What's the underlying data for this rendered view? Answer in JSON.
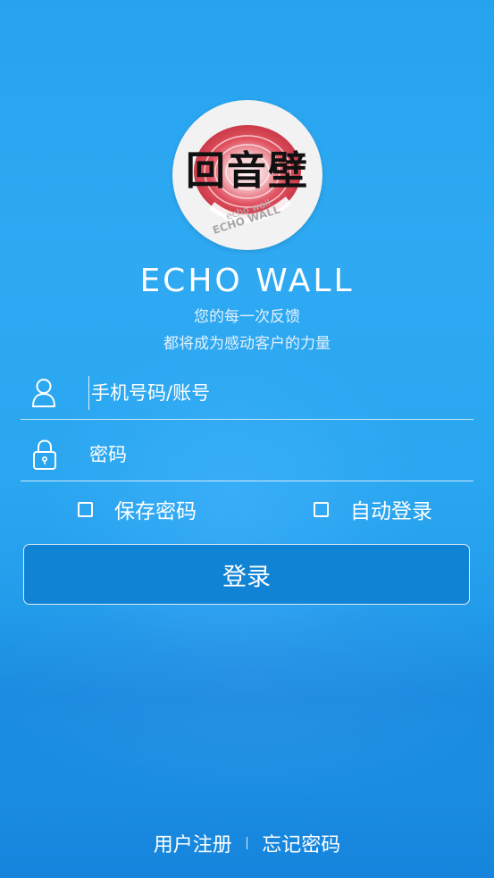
{
  "logo": {
    "chinese": "回音壁",
    "ring_text_1": "echo wall",
    "ring_text_2": "ECHO WALL"
  },
  "brand": {
    "name": "ECHO WALL",
    "tagline_1": "您的每一次反馈",
    "tagline_2": "都将成为感动客户的力量"
  },
  "form": {
    "account_placeholder": "手机号码/账号",
    "password_placeholder": "密码",
    "save_password_label": "保存密码",
    "auto_login_label": "自动登录",
    "save_password_checked": false,
    "auto_login_checked": false,
    "login_button": "登录"
  },
  "footer": {
    "register_link": "用户注册",
    "forgot_link": "忘记密码"
  },
  "icons": {
    "account": "user-icon",
    "password": "lock-icon"
  },
  "colors": {
    "background": "#2aa6f0",
    "button": "#1183d4",
    "logo_red": "#e04a5a"
  }
}
